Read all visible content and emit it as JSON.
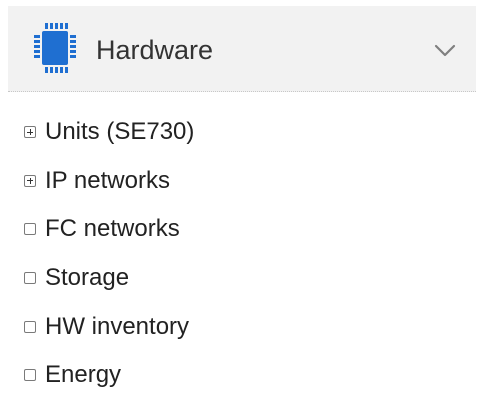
{
  "header": {
    "title": "Hardware",
    "icon": "chip-icon",
    "toggle_icon": "chevron-down-icon",
    "accent_color": "#1f6fd1"
  },
  "tree": {
    "items": [
      {
        "label": "Units (SE730)",
        "expandable": true
      },
      {
        "label": "IP networks",
        "expandable": true
      },
      {
        "label": "FC networks",
        "expandable": false
      },
      {
        "label": "Storage",
        "expandable": false
      },
      {
        "label": "HW inventory",
        "expandable": false
      },
      {
        "label": "Energy",
        "expandable": false
      }
    ]
  }
}
